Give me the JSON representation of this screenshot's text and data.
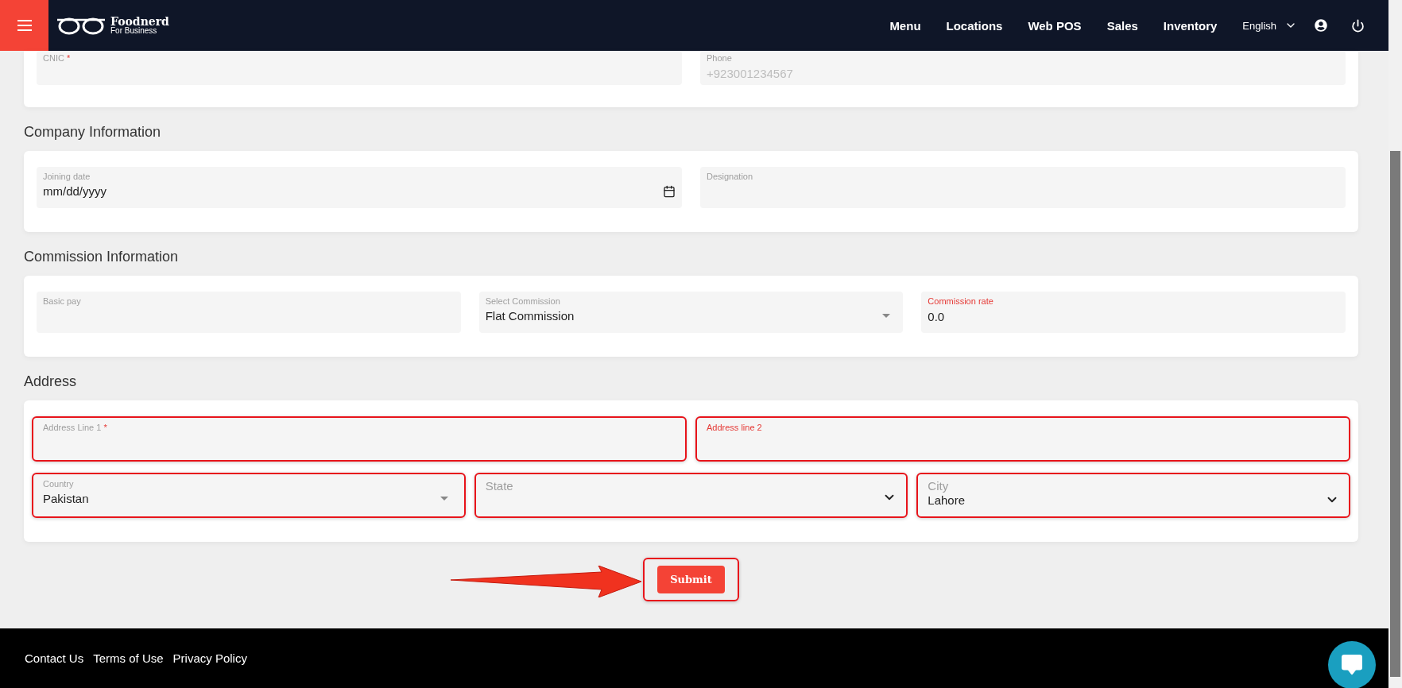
{
  "header": {
    "brand": "Foodnerd",
    "tagline": "For Business",
    "nav": [
      "Menu",
      "Locations",
      "Web POS",
      "Sales",
      "Inventory"
    ],
    "language": "English"
  },
  "sections": [
    {
      "rows": [
        [
          {
            "kind": "text",
            "label": "CNIC",
            "required_mark": "*",
            "invalid": false,
            "highlighted": false
          },
          {
            "kind": "text",
            "label": "Phone",
            "placeholder": "+923001234567",
            "invalid": false,
            "highlighted": false
          }
        ]
      ]
    },
    {
      "title": "Company Information",
      "rows": [
        [
          {
            "kind": "date",
            "label": "Joining date",
            "value": "mm/dd/yyyy",
            "invalid": false,
            "highlighted": false
          },
          {
            "kind": "text",
            "label": "Designation",
            "invalid": false,
            "highlighted": false
          }
        ]
      ]
    },
    {
      "title": "Commission Information",
      "rows": [
        [
          {
            "kind": "text",
            "label": "Basic pay",
            "invalid": false,
            "highlighted": false
          },
          {
            "kind": "select",
            "label": "Select Commission",
            "value": "Flat Commission",
            "invalid": false,
            "highlighted": false
          },
          {
            "kind": "text",
            "label": "Commission rate",
            "value": "0.0",
            "invalid": true,
            "highlighted": false
          }
        ]
      ]
    },
    {
      "title": "Address",
      "rows": [
        [
          {
            "kind": "text",
            "label": "Address Line 1",
            "required_mark": "*",
            "invalid": false,
            "highlighted": true
          },
          {
            "kind": "text",
            "label": "Address line 2",
            "invalid": true,
            "highlighted": true
          }
        ],
        [
          {
            "kind": "select",
            "label": "Country",
            "value": "Pakistan",
            "invalid": false,
            "highlighted": true
          },
          {
            "kind": "dropdown",
            "label": "State",
            "invalid": false,
            "highlighted": true
          },
          {
            "kind": "dropdown",
            "label": "City",
            "value": "Lahore",
            "invalid": false,
            "highlighted": true
          }
        ]
      ]
    }
  ],
  "submit": {
    "label": "Submit",
    "highlighted": true
  },
  "footer": {
    "links": [
      "Contact Us",
      "Terms of Use",
      "Privacy Policy"
    ]
  }
}
